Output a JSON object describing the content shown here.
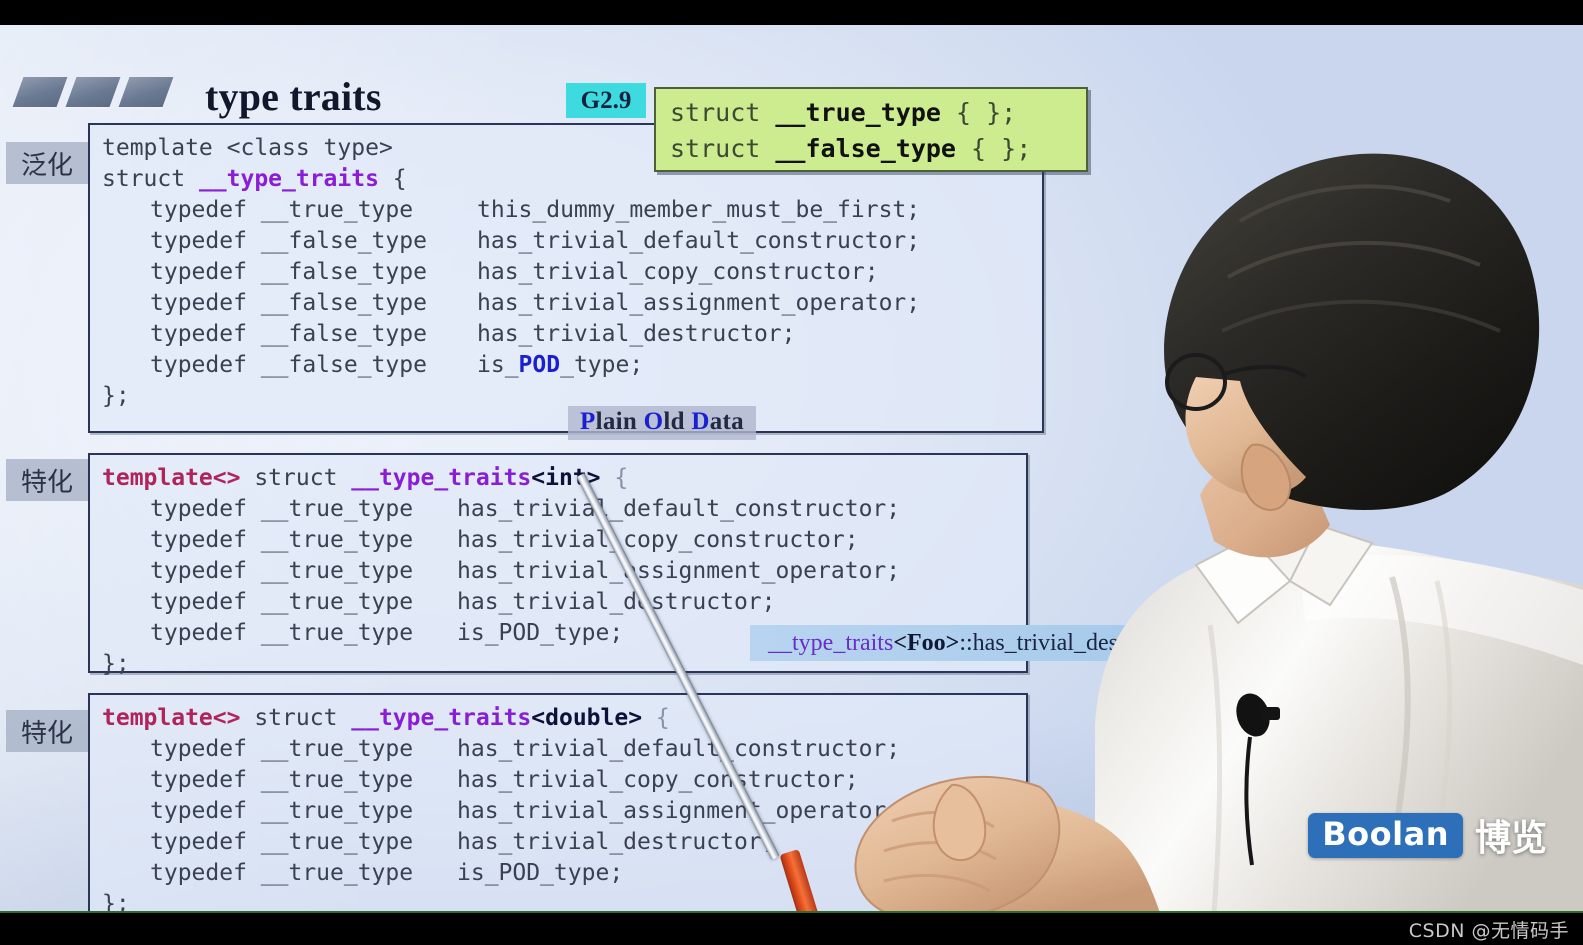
{
  "slide": {
    "title": "type traits",
    "version_badge": "G2.9",
    "logo_bars": 3
  },
  "green_box": {
    "line1_prefix": "struct ",
    "line1_name": "__true_type",
    "line1_suffix": " { };",
    "line2_prefix": "struct ",
    "line2_name": "__false_type",
    "line2_suffix": " { };"
  },
  "side_tags": {
    "generalization": "泛化",
    "specialization_int": "特化",
    "specialization_double": "特化"
  },
  "panel1": {
    "header_line1": "template <class type>",
    "header_line2_pre": "struct ",
    "header_line2_name": "__type_traits",
    "header_line2_post": " {",
    "rows": [
      {
        "typedef": "typedef __true_type",
        "member": "this_dummy_member_must_be_first;"
      },
      {
        "typedef": "typedef __false_type",
        "member": "has_trivial_default_constructor;"
      },
      {
        "typedef": "typedef __false_type",
        "member": "has_trivial_copy_constructor;"
      },
      {
        "typedef": "typedef __false_type",
        "member": "has_trivial_assignment_operator;"
      },
      {
        "typedef": "typedef __false_type",
        "member": "has_trivial_destructor;"
      },
      {
        "typedef": "typedef __false_type",
        "member_pre": "is_",
        "member_pod": "POD",
        "member_post": "_type;"
      }
    ],
    "closing": "};"
  },
  "pod_label": {
    "p": "P",
    "lain": "lain ",
    "o": "O",
    "ld": "ld ",
    "d": "D",
    "ata": "ata",
    "full": "Plain Old Data"
  },
  "panel2": {
    "header_tmpl": "template<>",
    "header_struct": " struct ",
    "header_name": "__type_traits",
    "header_arg": "<int>",
    "header_brace": " {",
    "rows": [
      {
        "typedef": "typedef __true_type",
        "member": "has_trivial_default_constructor;"
      },
      {
        "typedef": "typedef __true_type",
        "member": "has_trivial_copy_constructor;"
      },
      {
        "typedef": "typedef __true_type",
        "member": "has_trivial_assignment_operator;"
      },
      {
        "typedef": "typedef __true_type",
        "member": "has_trivial_destructor;"
      },
      {
        "typedef": "typedef __true_type",
        "member": "is_POD_type;"
      }
    ],
    "closing": "};"
  },
  "panel3": {
    "header_tmpl": "template<>",
    "header_struct": " struct ",
    "header_name": "__type_traits",
    "header_arg": "<double>",
    "header_brace": " {",
    "rows": [
      {
        "typedef": "typedef __true_type",
        "member": "has_trivial_default_constructor;"
      },
      {
        "typedef": "typedef __true_type",
        "member": "has_trivial_copy_constructor;"
      },
      {
        "typedef": "typedef __true_type",
        "member": "has_trivial_assignment_operator;"
      },
      {
        "typedef": "typedef __true_type",
        "member": "has_trivial_destructor;"
      },
      {
        "typedef": "typedef __true_type",
        "member": "is_POD_type;"
      }
    ],
    "closing": "};"
  },
  "tooltip": {
    "prefix": "__type_traits",
    "arg": "<Foo>",
    "suffix": "::has_trivial_destructo"
  },
  "branding": {
    "badge": "Boolan",
    "chinese": "博览"
  },
  "watermark": {
    "text": "CSDN @无情码手"
  },
  "colors": {
    "accent_cyan": "#3ddbe0",
    "green_box": "#cdeb8f",
    "purple_keyword": "#8a1ed6",
    "crimson_keyword": "#b0235b",
    "pod_blue": "#1a1fd0",
    "tooltip_blue": "#b8d4f0",
    "boolan_blue": "#2d6fb8"
  }
}
